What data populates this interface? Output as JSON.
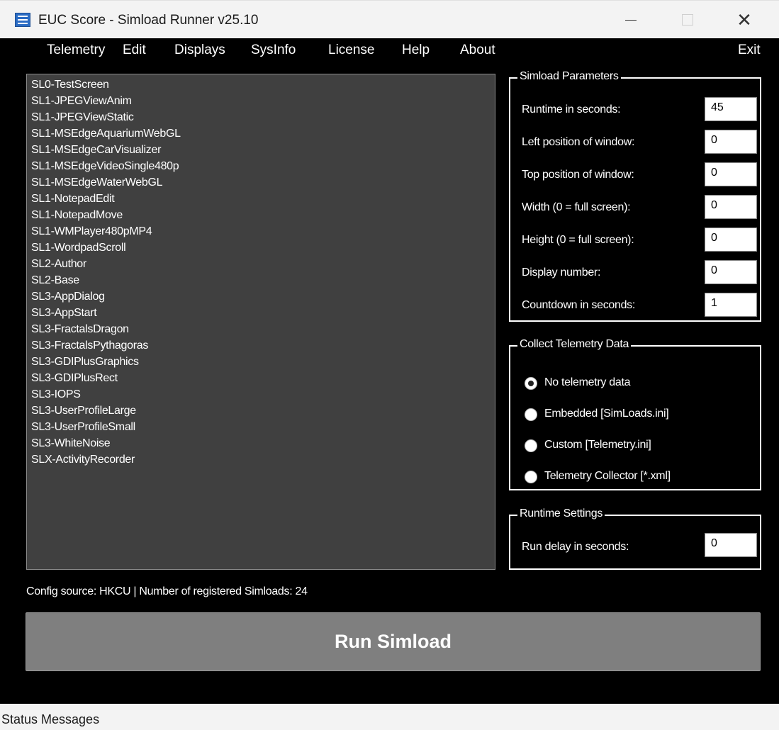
{
  "window": {
    "title": "EUC Score - Simload Runner v25.10",
    "min_symbol": "",
    "close_symbol": "✕"
  },
  "menu": {
    "items": [
      "Telemetry",
      "Edit",
      "Displays",
      "SysInfo",
      "License",
      "Help",
      "About"
    ],
    "exit": "Exit"
  },
  "simloads": [
    "SL0-TestScreen",
    "SL1-JPEGViewAnim",
    "SL1-JPEGViewStatic",
    "SL1-MSEdgeAquariumWebGL",
    "SL1-MSEdgeCarVisualizer",
    "SL1-MSEdgeVideoSingle480p",
    "SL1-MSEdgeWaterWebGL",
    "SL1-NotepadEdit",
    "SL1-NotepadMove",
    "SL1-WMPlayer480pMP4",
    "SL1-WordpadScroll",
    "SL2-Author",
    "SL2-Base",
    "SL3-AppDialog",
    "SL3-AppStart",
    "SL3-FractalsDragon",
    "SL3-FractalsPythagoras",
    "SL3-GDIPlusGraphics",
    "SL3-GDIPlusRect",
    "SL3-IOPS",
    "SL3-UserProfileLarge",
    "SL3-UserProfileSmall",
    "SL3-WhiteNoise",
    "SLX-ActivityRecorder"
  ],
  "simload_parameters": {
    "title": "Simload Parameters",
    "fields": [
      {
        "label": "Runtime in seconds:",
        "value": "45"
      },
      {
        "label": "Left position of window:",
        "value": "0"
      },
      {
        "label": "Top position of window:",
        "value": "0"
      },
      {
        "label": "Width (0 = full screen):",
        "value": "0"
      },
      {
        "label": "Height (0 = full screen):",
        "value": "0"
      },
      {
        "label": "Display number:",
        "value": "0"
      },
      {
        "label": "Countdown in seconds:",
        "value": "1"
      }
    ]
  },
  "telemetry": {
    "title": "Collect Telemetry Data",
    "options": [
      {
        "label": "No telemetry data",
        "checked": true
      },
      {
        "label": "Embedded [SimLoads.ini]",
        "checked": false
      },
      {
        "label": "Custom [Telemetry.ini]",
        "checked": false
      },
      {
        "label": "Telemetry Collector [*.xml]",
        "checked": false
      }
    ]
  },
  "runtime_settings": {
    "title": "Runtime Settings",
    "run_delay_label": "Run delay in seconds:",
    "run_delay_value": "0"
  },
  "config_source_text": "Config source: HKCU  |  Number of registered Simloads: 24",
  "run_button_label": "Run Simload",
  "status_text": "Status Messages"
}
